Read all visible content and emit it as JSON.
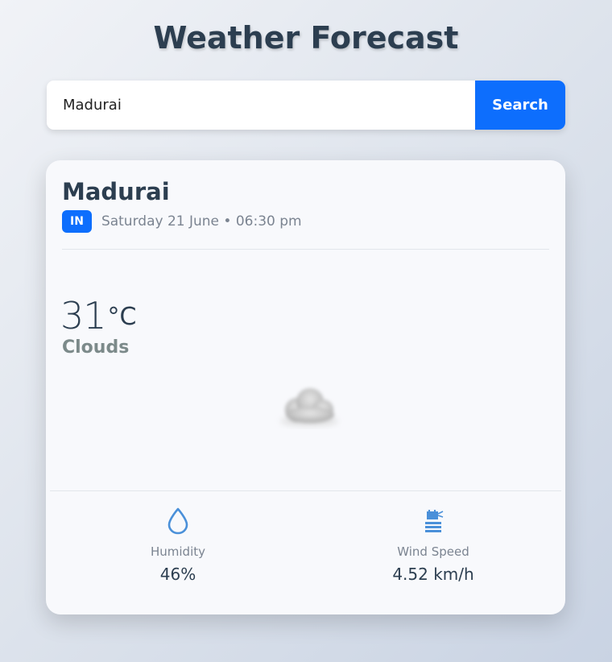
{
  "app": {
    "title": "Weather Forecast"
  },
  "search": {
    "value": "Madurai",
    "button_label": "Search"
  },
  "weather": {
    "city": "Madurai",
    "country_code": "IN",
    "datetime": "Saturday 21 June • 06:30 pm",
    "temperature": "31",
    "unit": "°C",
    "condition": "Clouds",
    "icon": "cloud-icon"
  },
  "stats": {
    "humidity": {
      "icon": "water-drop-icon",
      "label": "Humidity",
      "value": "46%"
    },
    "wind": {
      "icon": "wind-icon",
      "label": "Wind Speed",
      "value": "4.52 km/h"
    }
  },
  "colors": {
    "accent": "#0d6efd",
    "title": "#2c3e50",
    "muted": "#7b8491",
    "condition": "#7c8a8a",
    "icon_blue": "#4a90d9"
  }
}
